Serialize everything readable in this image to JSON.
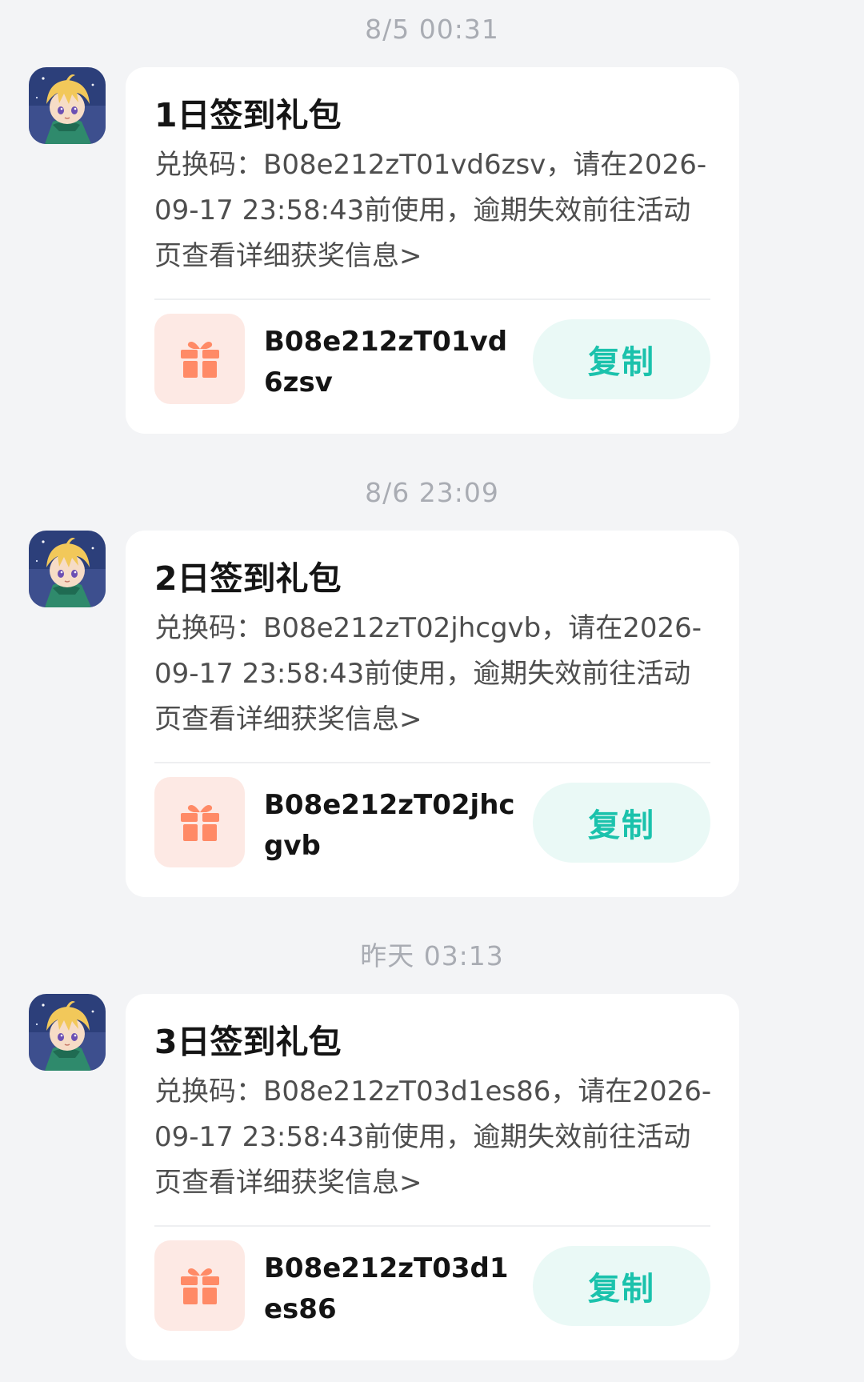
{
  "colors": {
    "page_background": "#f3f4f6",
    "card_background": "#ffffff",
    "timestamp_text": "#a9acb3",
    "title_text": "#151515",
    "body_text": "#4e4e4e",
    "copy_button_text": "#1bc2ac",
    "copy_button_background": "#eaf9f6",
    "gift_icon": "#ff8a66",
    "gift_tile_background": "#fde9e4"
  },
  "icons": {
    "avatar": "game-character-avatar-icon",
    "gift": "gift-box-icon"
  },
  "messages": [
    {
      "timestamp": "8/5  00:31",
      "title": "1日签到礼包",
      "body": "兑换码：B08e212zT01vd6zsv，请在2026-09-17 23:58:43前使用，逾期失效前往活动页查看详细获奖信息>",
      "code": "B08e212zT01vd6zsv",
      "copy_label": "复制"
    },
    {
      "timestamp": "8/6  23:09",
      "title": "2日签到礼包",
      "body": "兑换码：B08e212zT02jhcgvb，请在2026-09-17 23:58:43前使用，逾期失效前往活动页查看详细获奖信息>",
      "code": "B08e212zT02jhcgvb",
      "copy_label": "复制"
    },
    {
      "timestamp": "昨天  03:13",
      "title": "3日签到礼包",
      "body": "兑换码：B08e212zT03d1es86，请在2026-09-17 23:58:43前使用，逾期失效前往活动页查看详细获奖信息>",
      "code": "B08e212zT03d1es86",
      "copy_label": "复制"
    }
  ]
}
